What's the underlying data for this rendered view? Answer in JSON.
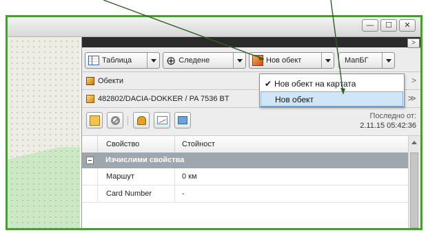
{
  "window": {
    "controls": [
      {
        "name": "minimize",
        "glyph": "—"
      },
      {
        "name": "maximize",
        "glyph": "☐"
      },
      {
        "name": "close",
        "glyph": "✕"
      }
    ]
  },
  "panel": {
    "collapse_glyph": ">"
  },
  "toolbar": {
    "table_label": "Таблица",
    "tracking_label": "Следене",
    "new_object_label": "Нов обект",
    "map_label": "МапБГ"
  },
  "new_object_menu": {
    "items": [
      {
        "label": "Нов обект на картата",
        "checked": true,
        "check_glyph": "✔"
      },
      {
        "label": "Нов обект",
        "checked": false,
        "highlighted": true
      }
    ]
  },
  "objects_section": {
    "title": "Обекти",
    "chevron": ">"
  },
  "vehicle": {
    "title": "482802/DACIA-DOKKER / PA 7536 BT",
    "chevron": "≫"
  },
  "tools": {
    "last_label": "Последно от:",
    "last_value": "2.11.15 05:42:36"
  },
  "grid": {
    "header": {
      "property": "Свойство",
      "value": "Стойност"
    },
    "group": "Изчислими свойства",
    "rows": [
      {
        "property": "Маршут",
        "value": "0 км"
      },
      {
        "property": "Card Number",
        "value": "-"
      }
    ]
  },
  "colors": {
    "frame_border": "#4a9a3a",
    "menu_highlight": "#cfe5f8",
    "group_header": "#9ea7ad",
    "annotation_line": "#2f5d24"
  }
}
